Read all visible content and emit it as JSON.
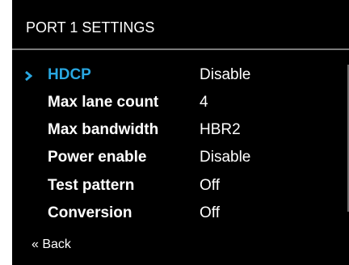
{
  "header": {
    "title": "PORT 1 SETTINGS"
  },
  "colors": {
    "background": "#000000",
    "text": "#ffffff",
    "selected_accent": "#29a7e1",
    "divider": "#7a7a7a"
  },
  "menu": {
    "items": [
      {
        "label": "HDCP",
        "value": "Disable",
        "selected": true
      },
      {
        "label": "Max lane count",
        "value": "4"
      },
      {
        "label": "Max bandwidth",
        "value": "HBR2"
      },
      {
        "label": "Power enable",
        "value": "Disable"
      },
      {
        "label": "Test pattern",
        "value": "Off"
      },
      {
        "label": "Conversion",
        "value": "Off"
      }
    ]
  },
  "back": {
    "label": "« Back"
  }
}
